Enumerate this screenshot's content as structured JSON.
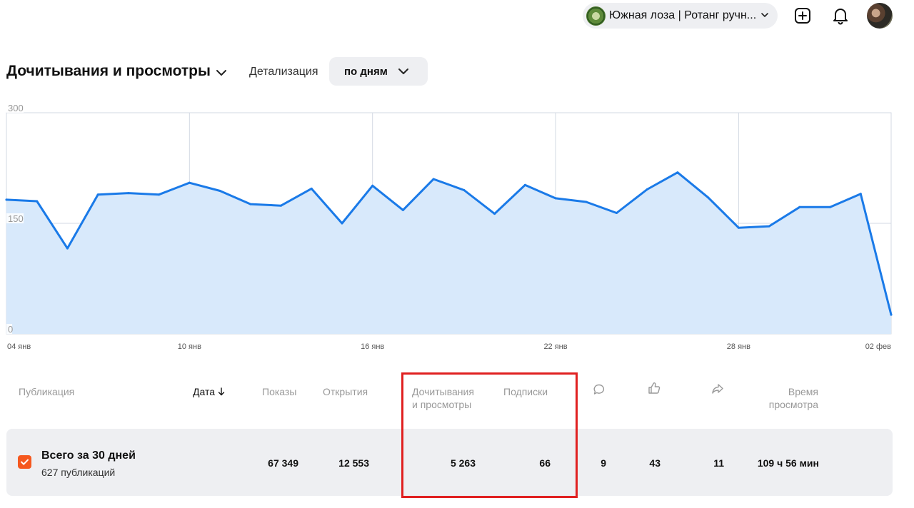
{
  "header": {
    "channel_name": "Южная лоза | Ротанг ручн...",
    "icons": [
      "add-icon",
      "bell-icon",
      "user-avatar"
    ]
  },
  "title": "Дочитывания и просмотры",
  "detail": {
    "label": "Детализация",
    "value": "по дням"
  },
  "chart_data": {
    "type": "area",
    "ylim": [
      0,
      300
    ],
    "yticks": [
      "300",
      "150",
      "0"
    ],
    "xtick_labels": [
      "04 янв",
      "10 янв",
      "16 янв",
      "22 янв",
      "28 янв",
      "02 фев"
    ],
    "x": [
      "04 янв",
      "05 янв",
      "06 янв",
      "07 янв",
      "08 янв",
      "09 янв",
      "10 янв",
      "11 янв",
      "12 янв",
      "13 янв",
      "14 янв",
      "15 янв",
      "16 янв",
      "17 янв",
      "18 янв",
      "19 янв",
      "20 янв",
      "21 янв",
      "22 янв",
      "23 янв",
      "24 янв",
      "25 янв",
      "26 янв",
      "27 янв",
      "28 янв",
      "29 янв",
      "30 янв",
      "31 янв",
      "01 фев",
      "02 фев"
    ],
    "values": [
      182,
      180,
      116,
      189,
      191,
      189,
      205,
      194,
      176,
      174,
      197,
      150,
      201,
      168,
      210,
      195,
      163,
      202,
      184,
      179,
      164,
      196,
      219,
      185,
      144,
      146,
      172,
      172,
      190,
      26
    ],
    "grid": true,
    "colors": {
      "line": "#1a7ae8",
      "fill": "#d8e9fb",
      "grid": "#d3d9e3"
    }
  },
  "table": {
    "headers": {
      "publication": "Публикация",
      "date": "Дата",
      "impressions": "Показы",
      "opens": "Открытия",
      "reads": [
        "Дочитывания",
        "и просмотры"
      ],
      "subscriptions": "Подписки",
      "watch_time": [
        "Время",
        "просмотра"
      ]
    },
    "header_icons": [
      "comment-icon",
      "like-icon",
      "share-icon",
      "sort-down-icon"
    ],
    "total": {
      "title": "Всего за 30 дней",
      "subtitle": "627 публикаций",
      "impressions": "67 349",
      "opens": "12 553",
      "reads": "5 263",
      "subscriptions": "66",
      "comments": "9",
      "likes": "43",
      "shares": "11",
      "watch_time": "109 ч 56 мин"
    }
  },
  "colors": {
    "accent": "#f5581f",
    "highlight": "#e02020",
    "chart_line": "#1a7ae8"
  }
}
